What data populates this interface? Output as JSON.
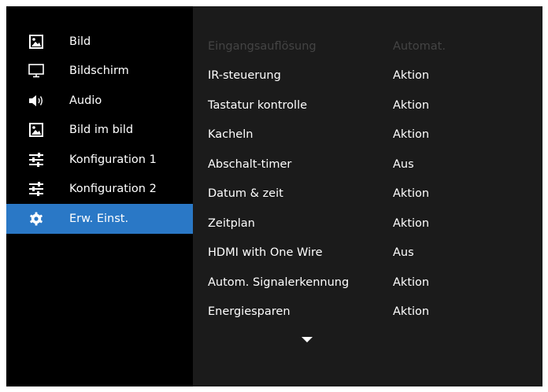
{
  "sidebar": {
    "items": [
      {
        "label": "Bild",
        "icon": "picture-icon",
        "active": false
      },
      {
        "label": "Bildschirm",
        "icon": "monitor-icon",
        "active": false
      },
      {
        "label": "Audio",
        "icon": "speaker-icon",
        "active": false
      },
      {
        "label": "Bild im bild",
        "icon": "picture-in-picture-icon",
        "active": false
      },
      {
        "label": "Konfiguration 1",
        "icon": "sliders-icon",
        "active": false
      },
      {
        "label": "Konfiguration 2",
        "icon": "sliders-icon",
        "active": false
      },
      {
        "label": "Erw. Einst.",
        "icon": "gear-icon",
        "active": true
      }
    ]
  },
  "settings": {
    "rows": [
      {
        "name": "Eingangsauflösung",
        "value": "Automat.",
        "enabled": false
      },
      {
        "name": "IR-steuerung",
        "value": "Aktion",
        "enabled": true
      },
      {
        "name": "Tastatur kontrolle",
        "value": "Aktion",
        "enabled": true
      },
      {
        "name": "Kacheln",
        "value": "Aktion",
        "enabled": true
      },
      {
        "name": "Abschalt-timer",
        "value": "Aus",
        "enabled": true
      },
      {
        "name": "Datum & zeit",
        "value": "Aktion",
        "enabled": true
      },
      {
        "name": "Zeitplan",
        "value": "Aktion",
        "enabled": true
      },
      {
        "name": "HDMI with One Wire",
        "value": "Aus",
        "enabled": true
      },
      {
        "name": "Autom. Signalerkennung",
        "value": "Aktion",
        "enabled": true
      },
      {
        "name": "Energiesparen",
        "value": "Aktion",
        "enabled": true
      }
    ],
    "scroll_icon": "chevron-down-icon"
  },
  "colors": {
    "accent": "#2a78c6",
    "sidebar_bg": "#000000",
    "content_bg": "#1b1b1b",
    "text": "#ffffff",
    "disabled_text": "#444444"
  }
}
